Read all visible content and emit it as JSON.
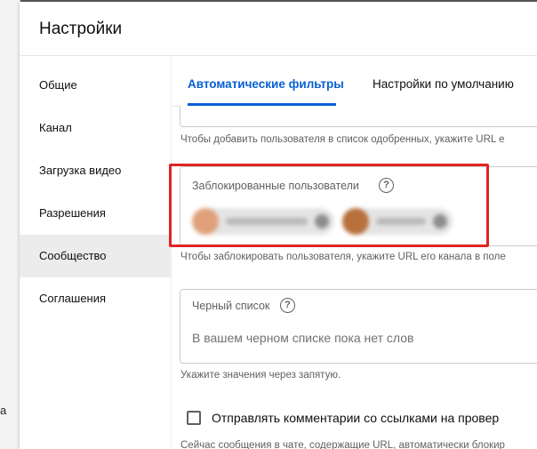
{
  "dialog": {
    "title": "Настройки"
  },
  "backdrop": {
    "partial_text": "а"
  },
  "nav": {
    "items": [
      {
        "label": "Общие",
        "active": false
      },
      {
        "label": "Канал",
        "active": false
      },
      {
        "label": "Загрузка видео",
        "active": false
      },
      {
        "label": "Разрешения",
        "active": false
      },
      {
        "label": "Сообщество",
        "active": true
      },
      {
        "label": "Соглашения",
        "active": false
      }
    ]
  },
  "tabs": [
    {
      "label": "Автоматические фильтры",
      "active": true
    },
    {
      "label": "Настройки по умолчанию",
      "active": false
    }
  ],
  "approved_users": {
    "hint": "Чтобы добавить пользователя в список одобренных, укажите URL е"
  },
  "blocked_users": {
    "label": "Заблокированные пользователи",
    "help_glyph": "?",
    "hint": "Чтобы заблокировать пользователя, укажите URL его канала в поле"
  },
  "blacklist": {
    "label": "Черный список",
    "help_glyph": "?",
    "empty_text": "В вашем черном списке пока нет слов",
    "hint": "Укажите значения через запятую."
  },
  "links_option": {
    "label": "Отправлять комментарии со ссылками на провер",
    "checked": false,
    "hint": "Сейчас сообщения в чате, содержащие URL, автоматически блокир"
  },
  "colors": {
    "accent": "#065fd4",
    "highlight": "#e02424"
  }
}
